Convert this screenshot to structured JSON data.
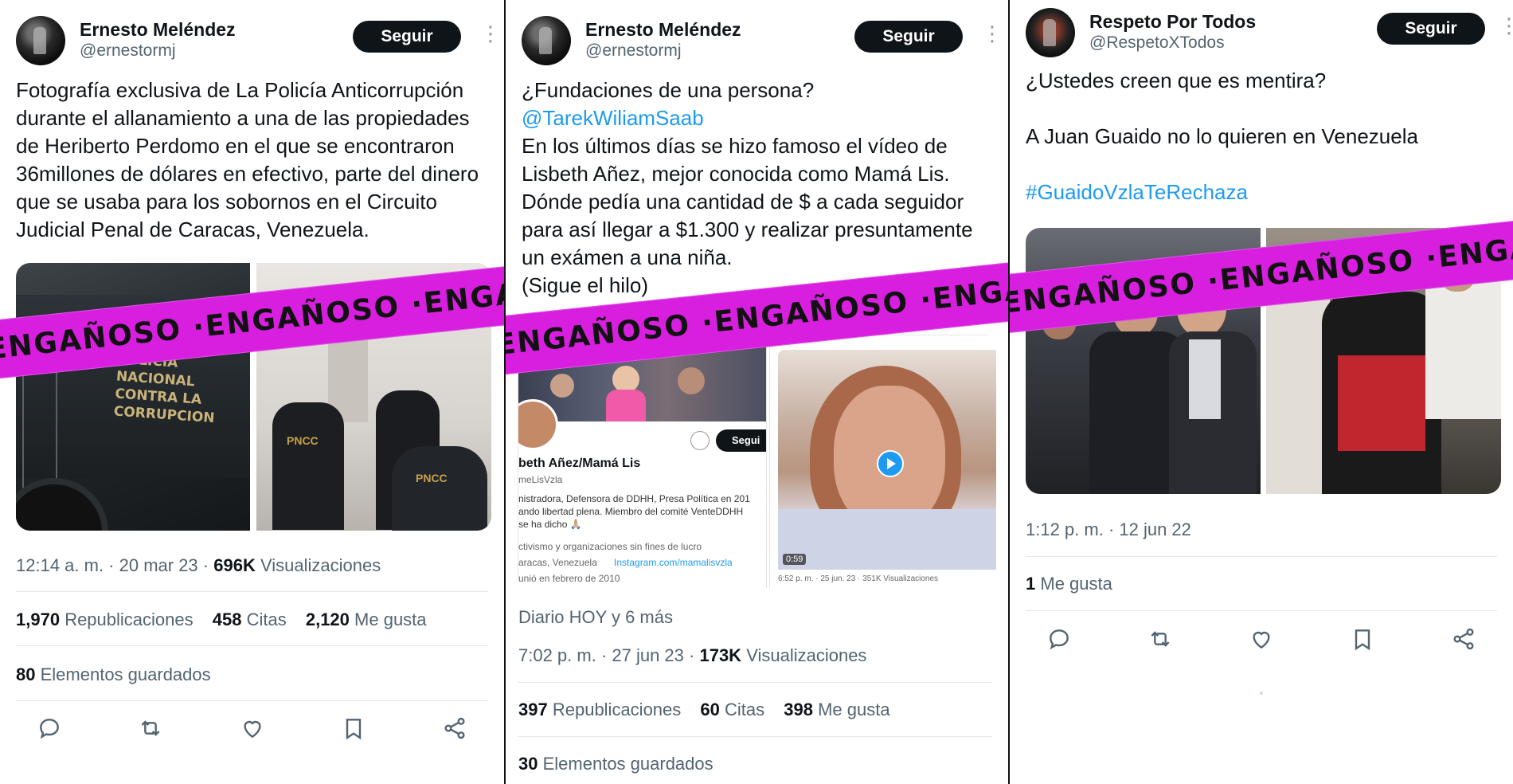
{
  "stamp_text": "ENGAÑOSO ·ENGAÑOSO ·ENGAÑOSO ·ENGAÑOSO ·ENGAÑOSO",
  "colors": {
    "stamp": "#d81fe0",
    "link": "#1d9bf0",
    "button": "#0f1419"
  },
  "tweets": [
    {
      "name": "Ernesto Meléndez",
      "handle": "@ernestormj",
      "follow_label": "Seguir",
      "text": "Fotografía exclusiva de La Policía Anticorrupción durante el allanamiento a una de las propiedades de Heriberto Perdomo en el que se encontraron 36millones de dólares en efectivo, parte del dinero que se usaba para los sobornos en el Circuito Judicial Penal de Caracas, Venezuela.",
      "photo_text": "POLICIA NACIONAL CONTRA LA CORRUPCION",
      "photo2_text": "PNCC",
      "time": "12:14 a. m. · 20 mar 23 ·",
      "views": "696K",
      "views_label": "Visualizaciones",
      "reposts": "1,970",
      "reposts_label": "Republicaciones",
      "quotes": "458",
      "quotes_label": "Citas",
      "likes": "2,120",
      "likes_label": "Me gusta",
      "bookmarks": "80",
      "bookmarks_label": "Elementos guardados"
    },
    {
      "name": "Ernesto Meléndez",
      "handle": "@ernestormj",
      "follow_label": "Seguir",
      "text_lines": [
        "¿Fundaciones de una persona?"
      ],
      "mention": "@TarekWiliamSaab",
      "text_rest": "En los últimos días se hizo famoso el vídeo de Lisbeth Añez, mejor conocida como Mamá Lis. Dónde pedía una cantidad de $ a cada seguidor para así llegar a $1.300 y realizar presuntamente un exámen a una niña.",
      "text_end": "(Sigue el hilo)",
      "embed": {
        "follow": "Segui",
        "name": "beth Añez/Mamá Lis",
        "handle": "meLisVzla",
        "bio1": "nistradora, Defensora de DDHH, Presa Política en 201",
        "bio2": "ando libertad plena. Miembro del comité VenteDDHH",
        "bio3": "se ha dicho 🙏🏼",
        "category": "ctivismo y organizaciones sin fines de lucro",
        "location": "aracas, Venezuela",
        "site": "Instagram.com/mamalisvzla",
        "joined": "unió en febrero de 2010",
        "video_time": "0:59",
        "video_meta": "6:52 p. m. · 25 jun. 23 · 351K Visualizaciones"
      },
      "context": "Diario HOY y 6 más",
      "time": "7:02 p. m. · 27 jun 23 ·",
      "views": "173K",
      "views_label": "Visualizaciones",
      "reposts": "397",
      "reposts_label": "Republicaciones",
      "quotes": "60",
      "quotes_label": "Citas",
      "likes": "398",
      "likes_label": "Me gusta",
      "bookmarks": "30",
      "bookmarks_label": "Elementos guardados"
    },
    {
      "name": "Respeto Por Todos",
      "handle": "@RespetoXTodos",
      "follow_label": "Seguir",
      "text1": "¿Ustedes creen que es mentira?",
      "text2": "A Juan Guaido no lo quieren en Venezuela",
      "hashtag": "#GuaidoVzlaTeRechaza",
      "time": "1:12 p. m. · 12 jun 22",
      "likes": "1",
      "likes_label": "Me gusta"
    }
  ]
}
